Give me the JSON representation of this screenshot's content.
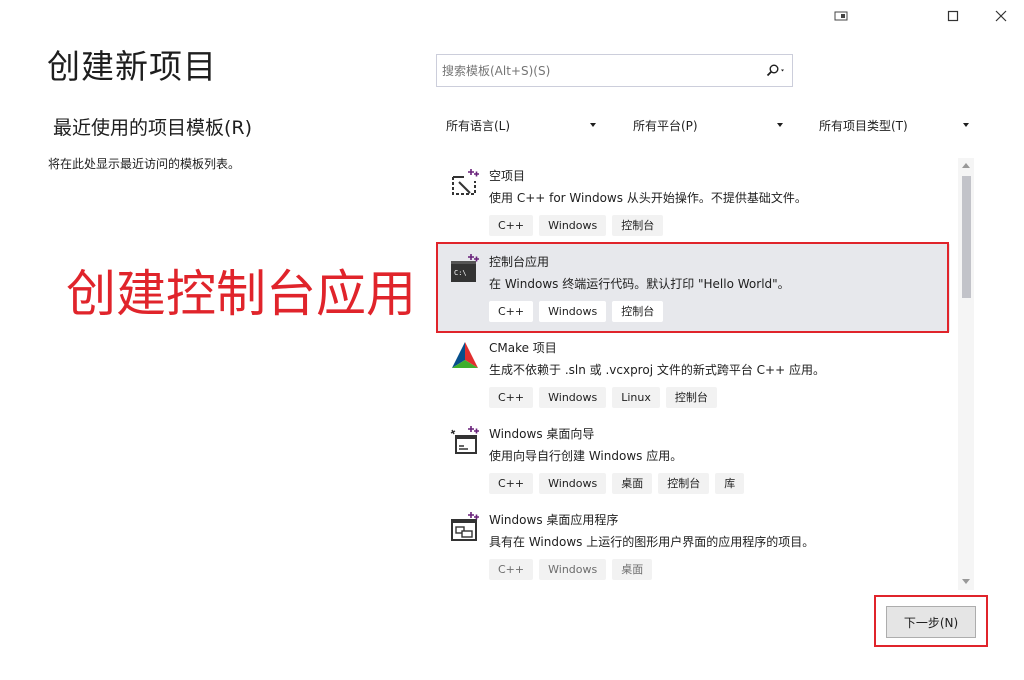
{
  "page_title": "创建新项目",
  "recent": {
    "title": "最近使用的项目模板(R)",
    "empty_text": "将在此处显示最近访问的模板列表。"
  },
  "annotation_text": "创建控制台应用",
  "search": {
    "placeholder": "搜索模板(Alt+S)(S)"
  },
  "filters": {
    "language": "所有语言(L)",
    "platform": "所有平台(P)",
    "project_type": "所有项目类型(T)"
  },
  "templates": [
    {
      "name": "空项目",
      "description": "使用 C++ for Windows 从头开始操作。不提供基础文件。",
      "tags": [
        "C++",
        "Windows",
        "控制台"
      ],
      "icon": "empty-project-icon"
    },
    {
      "name": "控制台应用",
      "description": "在 Windows 终端运行代码。默认打印 \"Hello World\"。",
      "tags": [
        "C++",
        "Windows",
        "控制台"
      ],
      "icon": "console-app-icon",
      "icon_text": "C:\\"
    },
    {
      "name": "CMake 项目",
      "description": "生成不依赖于 .sln 或 .vcxproj 文件的新式跨平台 C++ 应用。",
      "tags": [
        "C++",
        "Windows",
        "Linux",
        "控制台"
      ],
      "icon": "cmake-icon"
    },
    {
      "name": "Windows 桌面向导",
      "description": "使用向导自行创建 Windows 应用。",
      "tags": [
        "C++",
        "Windows",
        "桌面",
        "控制台",
        "库"
      ],
      "icon": "wizard-icon"
    },
    {
      "name": "Windows 桌面应用程序",
      "description": "具有在 Windows 上运行的图形用户界面的应用程序的项目。",
      "tags": [
        "C++",
        "Windows",
        "桌面"
      ],
      "icon": "desktop-app-icon"
    }
  ],
  "next_button": "下一步(N)",
  "colors": {
    "accent_red": "#e0242b",
    "selected_bg": "#e7e8ec",
    "vs_purple": "#68217a"
  }
}
